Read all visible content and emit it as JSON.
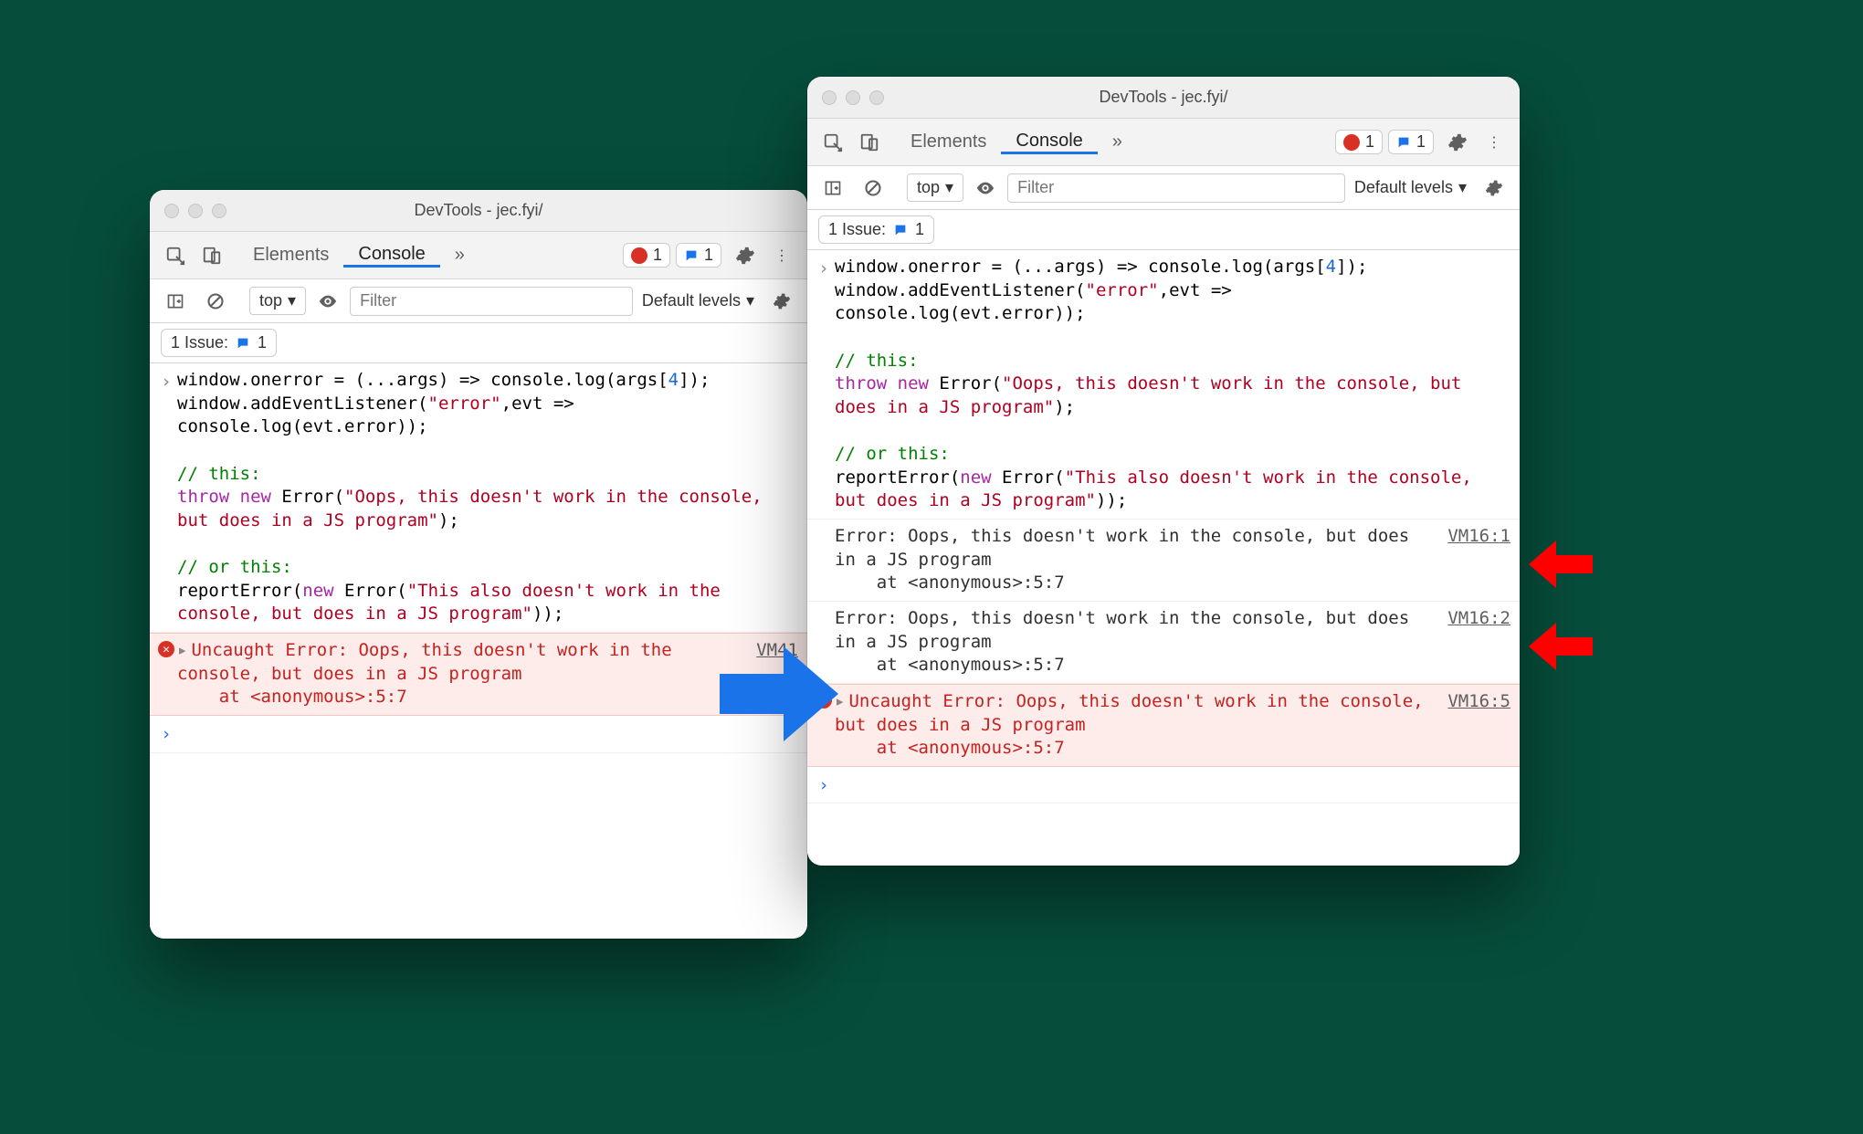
{
  "window_title": "DevTools - jec.fyi/",
  "tabs": {
    "elements": "Elements",
    "console": "Console"
  },
  "badges": {
    "errors": "1",
    "messages": "1"
  },
  "toolbar": {
    "context": "top",
    "filter_placeholder": "Filter",
    "levels": "Default levels"
  },
  "issues": {
    "label": "1 Issue:",
    "count": "1"
  },
  "code": {
    "l1a": "window.onerror = (...args) => console.log(args[",
    "l1b": "4",
    "l1c": "]);",
    "l2a": "window.addEventListener(",
    "l2b": "\"error\"",
    "l2c": ",evt => ",
    "l3": "console.log(evt.error));",
    "c1": "// this:",
    "t1a": "throw",
    "t1b": " new",
    "t1c": " Error(",
    "t1d": "\"Oops, this doesn't work in the console, but does in a JS program\"",
    "t1e": ");",
    "c2": "// or this:",
    "r1a": "reportError(",
    "r1b": "new",
    "r1c": " Error(",
    "r1d": "\"This also doesn't work in the console, but does in a JS program\"",
    "r1e": "));"
  },
  "logs": {
    "stack_a": "Error: Oops, this doesn't work in the console, but does in a JS program",
    "stack_b": "    at <anonymous>:5:7",
    "uncaught": "Uncaught Error: Oops, this doesn't work in the console, but does in a JS program",
    "uncaught_at": "    at <anonymous>:5:7"
  },
  "links": {
    "left_err": "VM41",
    "r_log1": "VM16:1",
    "r_log2": "VM16:2",
    "r_err": "VM16:5"
  }
}
